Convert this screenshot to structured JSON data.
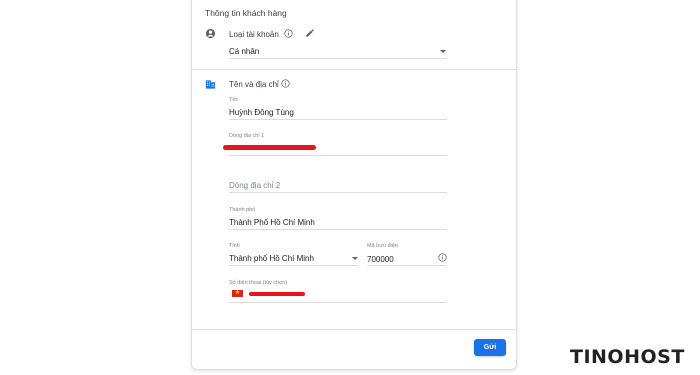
{
  "form": {
    "section_title": "Thông tin khách hàng",
    "account_type": {
      "label": "Loại tài khoản",
      "value": "Cá nhân"
    },
    "name_address": {
      "label": "Tên và địa chỉ",
      "name_label": "Tên",
      "name_value": "Huỳnh Đông Tùng",
      "address1_label": "Dòng địa chỉ 1",
      "address2_placeholder": "Dòng địa chỉ 2",
      "city_label": "Thành phố",
      "city_value": "Thành Phố Hồ Chí Minh",
      "province_label": "Tỉnh",
      "province_value": "Thành phố Hồ Chí Minh",
      "postal_label": "Mã bưu điện",
      "postal_value": "700000",
      "phone_label": "Số điện thoại (tùy chọn)"
    },
    "submit_label": "Gửi"
  },
  "brand": {
    "logo_text_left": "TINO",
    "logo_text_right": "HOST",
    "accent_color": "#1e9a8a"
  },
  "colors": {
    "primary_button": "#1a73e8",
    "redaction": "#e8141c"
  },
  "icons": [
    "account-circle-icon",
    "info-icon",
    "edit-pencil-icon",
    "building-icon",
    "info-icon",
    "dropdown-arrow-icon",
    "vietnam-flag-icon"
  ]
}
